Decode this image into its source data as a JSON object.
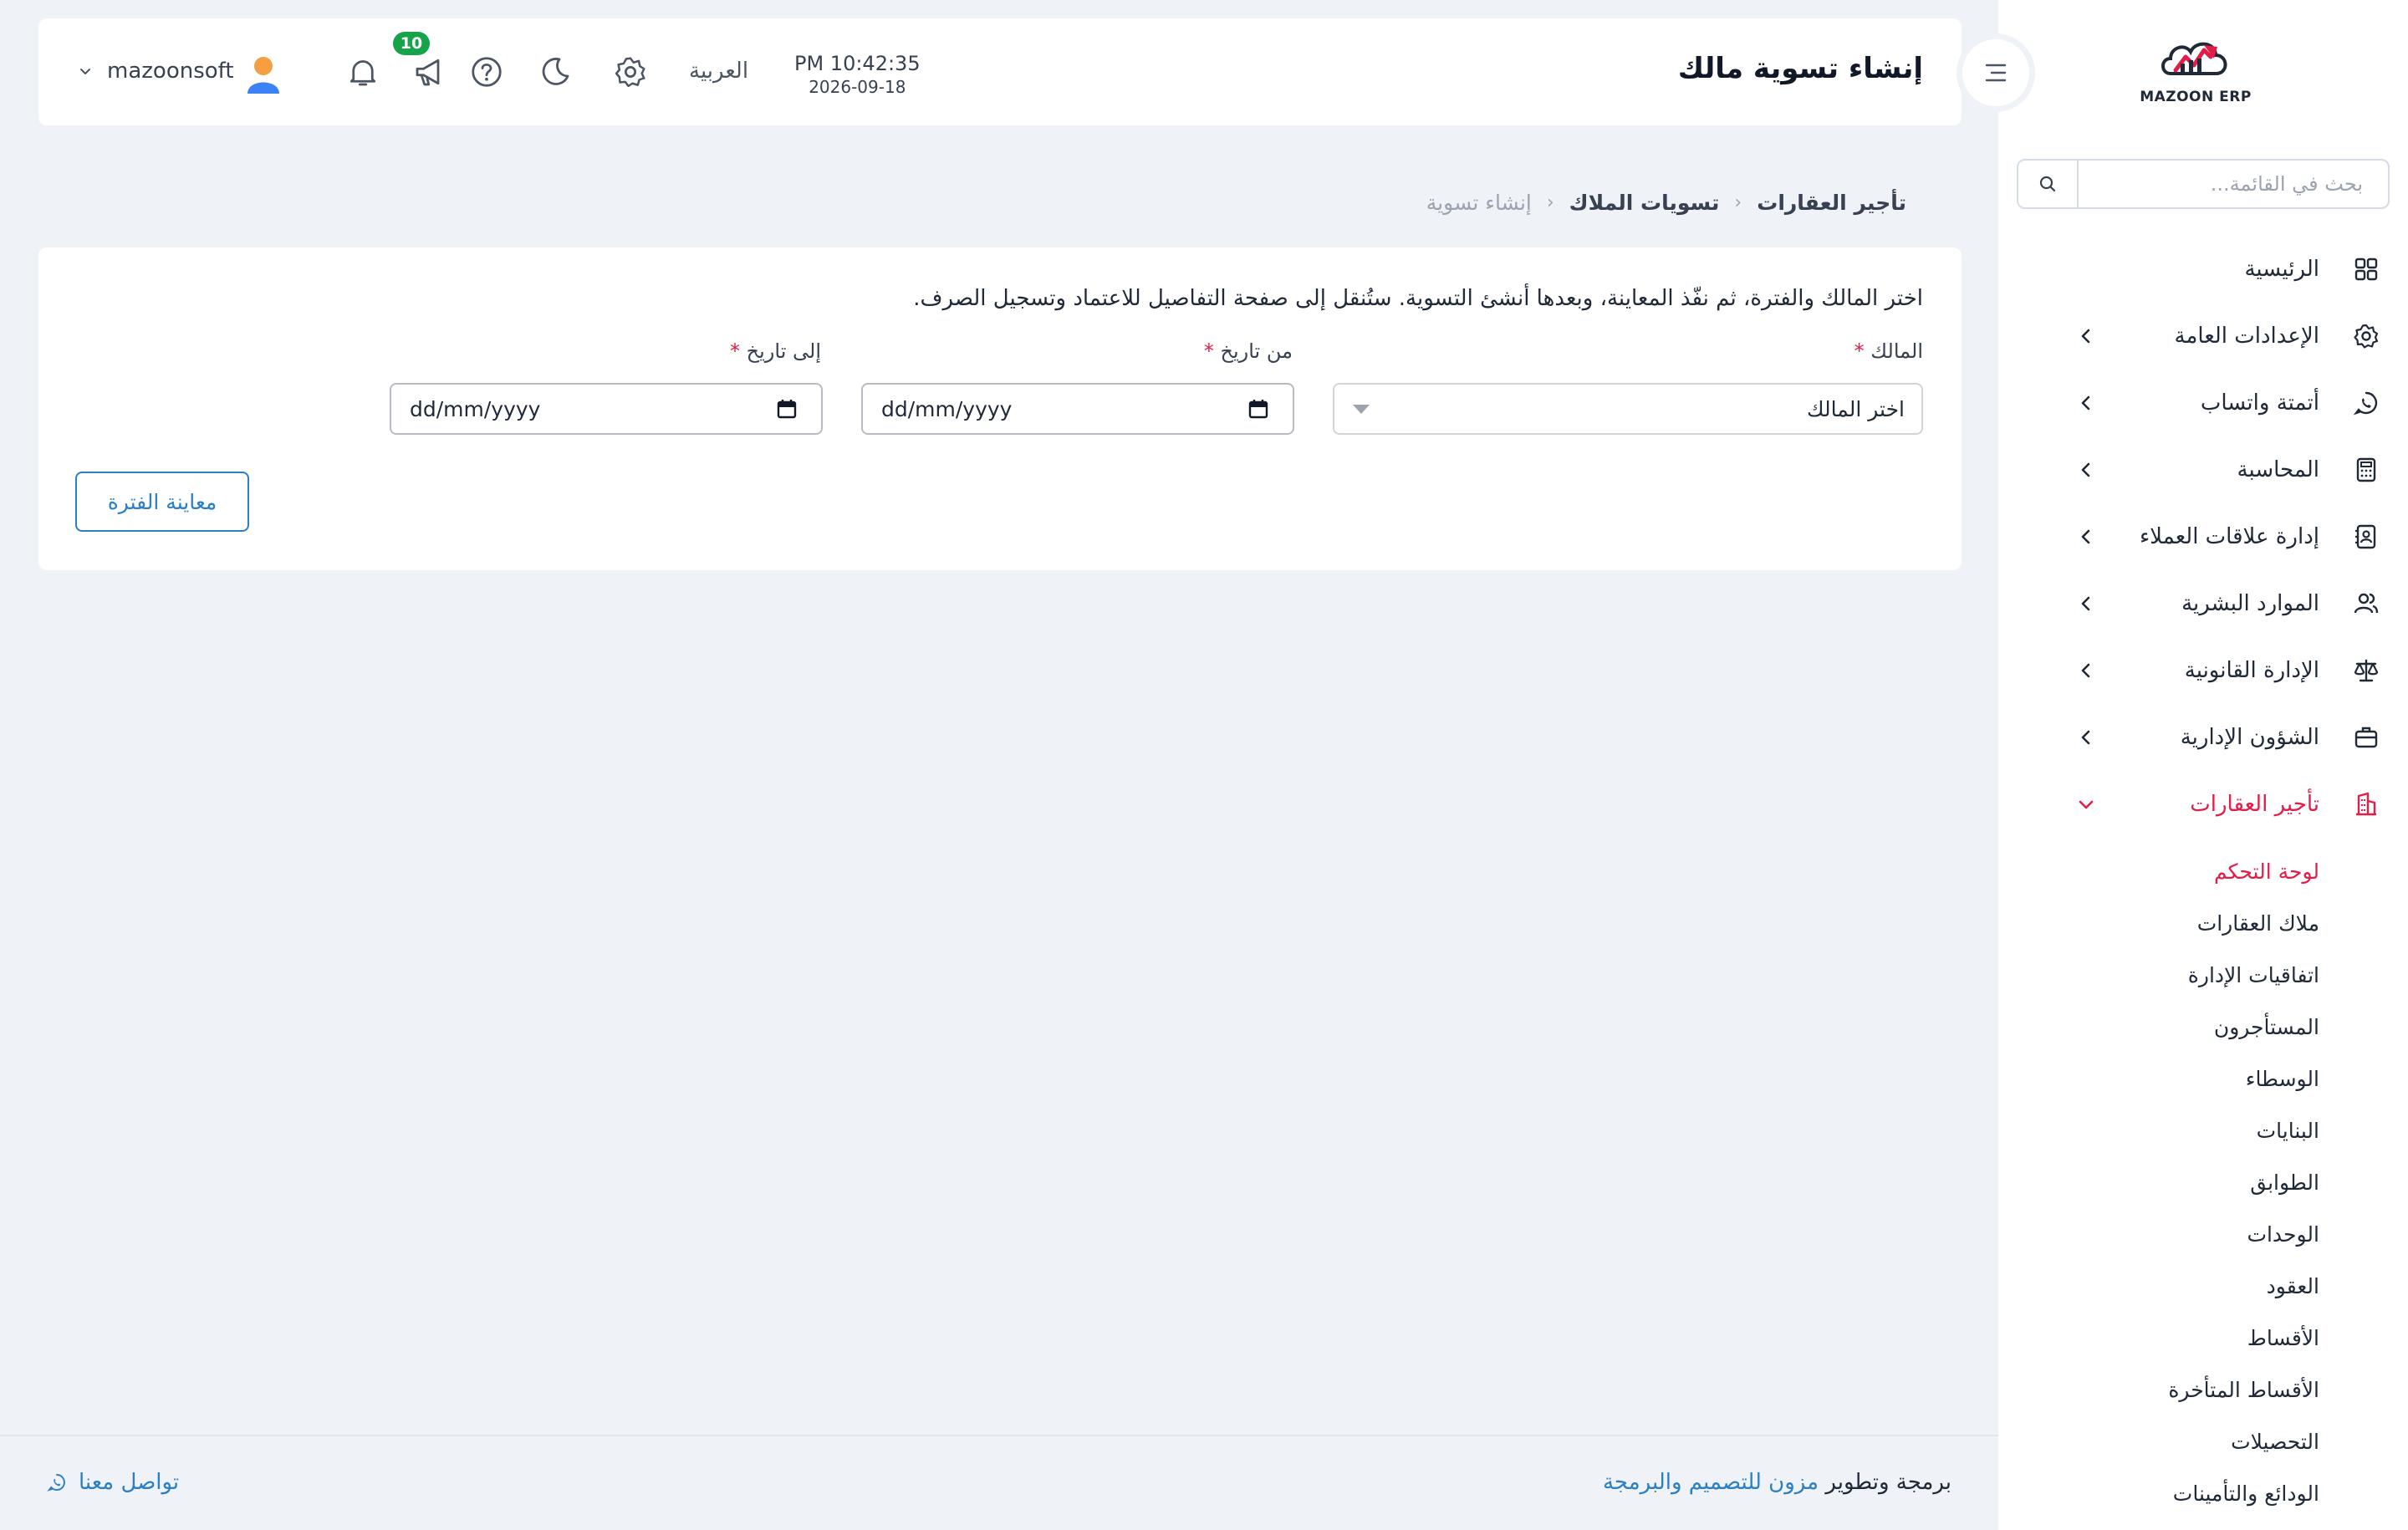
{
  "sidebar": {
    "logo_text": "MAZOON ERP",
    "search_placeholder": "بحث في القائمة...",
    "items": [
      {
        "label": "الرئيسية"
      },
      {
        "label": "الإعدادات العامة"
      },
      {
        "label": "أتمتة واتساب"
      },
      {
        "label": "المحاسبة"
      },
      {
        "label": "إدارة علاقات العملاء"
      },
      {
        "label": "الموارد البشرية"
      },
      {
        "label": "الإدارة القانونية"
      },
      {
        "label": "الشؤون الإدارية"
      },
      {
        "label": "تأجير العقارات"
      }
    ],
    "subitems": [
      {
        "label": "لوحة التحكم"
      },
      {
        "label": "ملاك العقارات"
      },
      {
        "label": "اتفاقيات الإدارة"
      },
      {
        "label": "المستأجرون"
      },
      {
        "label": "الوسطاء"
      },
      {
        "label": "البنايات"
      },
      {
        "label": "الطوابق"
      },
      {
        "label": "الوحدات"
      },
      {
        "label": "العقود"
      },
      {
        "label": "الأقساط"
      },
      {
        "label": "الأقساط المتأخرة"
      },
      {
        "label": "التحصيلات"
      },
      {
        "label": "الودائع والتأمينات"
      }
    ],
    "active_color": "#e11d48"
  },
  "header": {
    "title": "إنشاء تسوية مالك",
    "time": "PM 10:42:35",
    "date": "2026-09-18",
    "language": "العربية",
    "notifications_count": "10",
    "username": "mazoonsoft"
  },
  "breadcrumb": {
    "root": "تأجير العقارات",
    "section": "تسويات الملاك",
    "current": "إنشاء تسوية"
  },
  "form": {
    "hint": "اختر المالك والفترة، ثم نفّذ المعاينة، وبعدها أنشئ التسوية. ستُنقل إلى صفحة التفاصيل للاعتماد وتسجيل الصرف.",
    "owner_label": "المالك",
    "owner_value": "اختر المالك",
    "from_label": "من تاريخ",
    "to_label": "إلى تاريخ",
    "date_format": "dd/mm/yyyy",
    "required_mark": "*",
    "preview_button": "معاينة الفترة"
  },
  "footer": {
    "credit_prefix": "برمجة وتطوير",
    "credit_brand": "مزون للتصميم والبرمجة",
    "contact": "تواصل معنا"
  },
  "colors": {
    "accent": "#2b7fc4",
    "danger": "#e11d48",
    "badge": "#16a34a",
    "background": "#eff3f7"
  },
  "icons": [
    "search-icon",
    "grid-icon",
    "gear-icon",
    "whatsapp-icon",
    "calculator-icon",
    "address-book-icon",
    "users-icon",
    "scale-icon",
    "briefcase-icon",
    "building-icon",
    "chevron-icon",
    "menu-toggle-icon",
    "moon-icon",
    "help-icon",
    "megaphone-icon",
    "bell-icon",
    "user-avatar-icon",
    "calendar-icon"
  ]
}
